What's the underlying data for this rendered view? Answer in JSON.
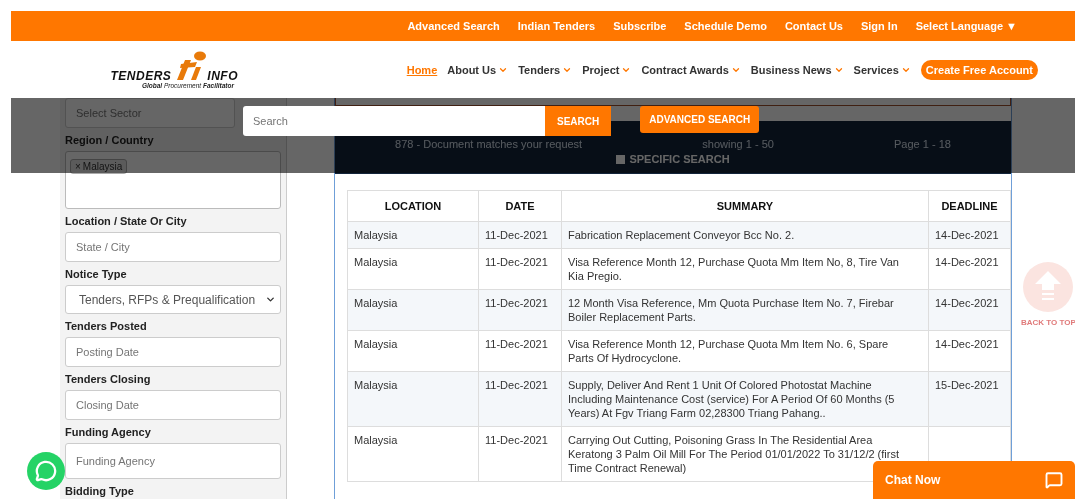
{
  "top_links": [
    "Advanced Search",
    "Indian Tenders",
    "Subscribe",
    "Schedule Demo",
    "Contact Us",
    "Sign In"
  ],
  "language": {
    "label": "Select Language",
    "caret": "▼"
  },
  "logo": {
    "left": "TENDERS",
    "right": "INFO",
    "tagline": "**Global** Procurement **Facilitator**"
  },
  "nav": [
    {
      "label": "Home",
      "selected": true,
      "has_menu": false
    },
    {
      "label": "About Us",
      "selected": false,
      "has_menu": true
    },
    {
      "label": "Tenders",
      "selected": false,
      "has_menu": true
    },
    {
      "label": "Project",
      "selected": false,
      "has_menu": true
    },
    {
      "label": "Contract Awards",
      "selected": false,
      "has_menu": true
    },
    {
      "label": "Business News",
      "selected": false,
      "has_menu": true
    },
    {
      "label": "Services",
      "selected": false,
      "has_menu": true
    }
  ],
  "cta": "Create Free Account",
  "search": {
    "placeholder": "Search",
    "button": "SEARCH",
    "advanced": "ADVANCED SEARCH"
  },
  "sidebar": [
    {
      "kind": "field",
      "placeholder": "Select Sector"
    },
    {
      "kind": "label",
      "text": "Region / Country"
    },
    {
      "kind": "tags",
      "tags": [
        "Malaysia"
      ],
      "remove": "×"
    },
    {
      "kind": "label",
      "text": "Location / State Or City"
    },
    {
      "kind": "field",
      "placeholder": "State / City"
    },
    {
      "kind": "label",
      "text": "Notice Type"
    },
    {
      "kind": "select",
      "value": "Tenders, RFPs & Prequalification"
    },
    {
      "kind": "label",
      "text": "Tenders Posted"
    },
    {
      "kind": "field",
      "placeholder": "Posting Date"
    },
    {
      "kind": "label",
      "text": "Tenders Closing"
    },
    {
      "kind": "field",
      "placeholder": "Closing Date"
    },
    {
      "kind": "label",
      "text": "Funding Agency"
    },
    {
      "kind": "tall_field",
      "placeholder": "Funding Agency"
    },
    {
      "kind": "label",
      "text": "Bidding Type"
    }
  ],
  "results": {
    "count": "878 - Document matches your request",
    "showing": "showing 1 - 50",
    "page": "Page 1 - 18",
    "specific_search": {
      "label": "SPECIFIC SEARCH",
      "checked": false
    }
  },
  "table": {
    "columns": [
      "LOCATION",
      "DATE",
      "SUMMARY",
      "DEADLINE"
    ],
    "rows": [
      [
        "Malaysia",
        "11-Dec-2021",
        "Fabrication Replacement Conveyor Bcc No. 2.",
        "14-Dec-2021"
      ],
      [
        "Malaysia",
        "11-Dec-2021",
        "Visa Reference Month 12, Purchase Quota Mm Item No, 8, Tire Van Kia Pregio.",
        "14-Dec-2021"
      ],
      [
        "Malaysia",
        "11-Dec-2021",
        "12 Month Visa Reference, Mm Quota Purchase Item No. 7, Firebar Boiler Replacement Parts.",
        "14-Dec-2021"
      ],
      [
        "Malaysia",
        "11-Dec-2021",
        "Visa Reference Month 12, Purchase Quota Mm Item No. 6, Spare Parts Of Hydrocyclone.",
        "14-Dec-2021"
      ],
      [
        "Malaysia",
        "11-Dec-2021",
        "Supply, Deliver And Rent 1 Unit Of Colored Photostat Machine Including Maintenance Cost (service) For A Period Of 60 Months (5 Years) At Fgv Triang Farm 02,28300 Triang Pahang..",
        "15-Dec-2021"
      ],
      [
        "Malaysia",
        "11-Dec-2021",
        "Carrying Out Cutting, Poisoning Grass In The Residential Area Keratong 3 Palm Oil Mill For The Period 01/01/2022 To 31/12/2 (first Time Contract Renewal)",
        ""
      ]
    ]
  },
  "back_to_top": "BACK TO TOP",
  "chat": "Chat Now"
}
